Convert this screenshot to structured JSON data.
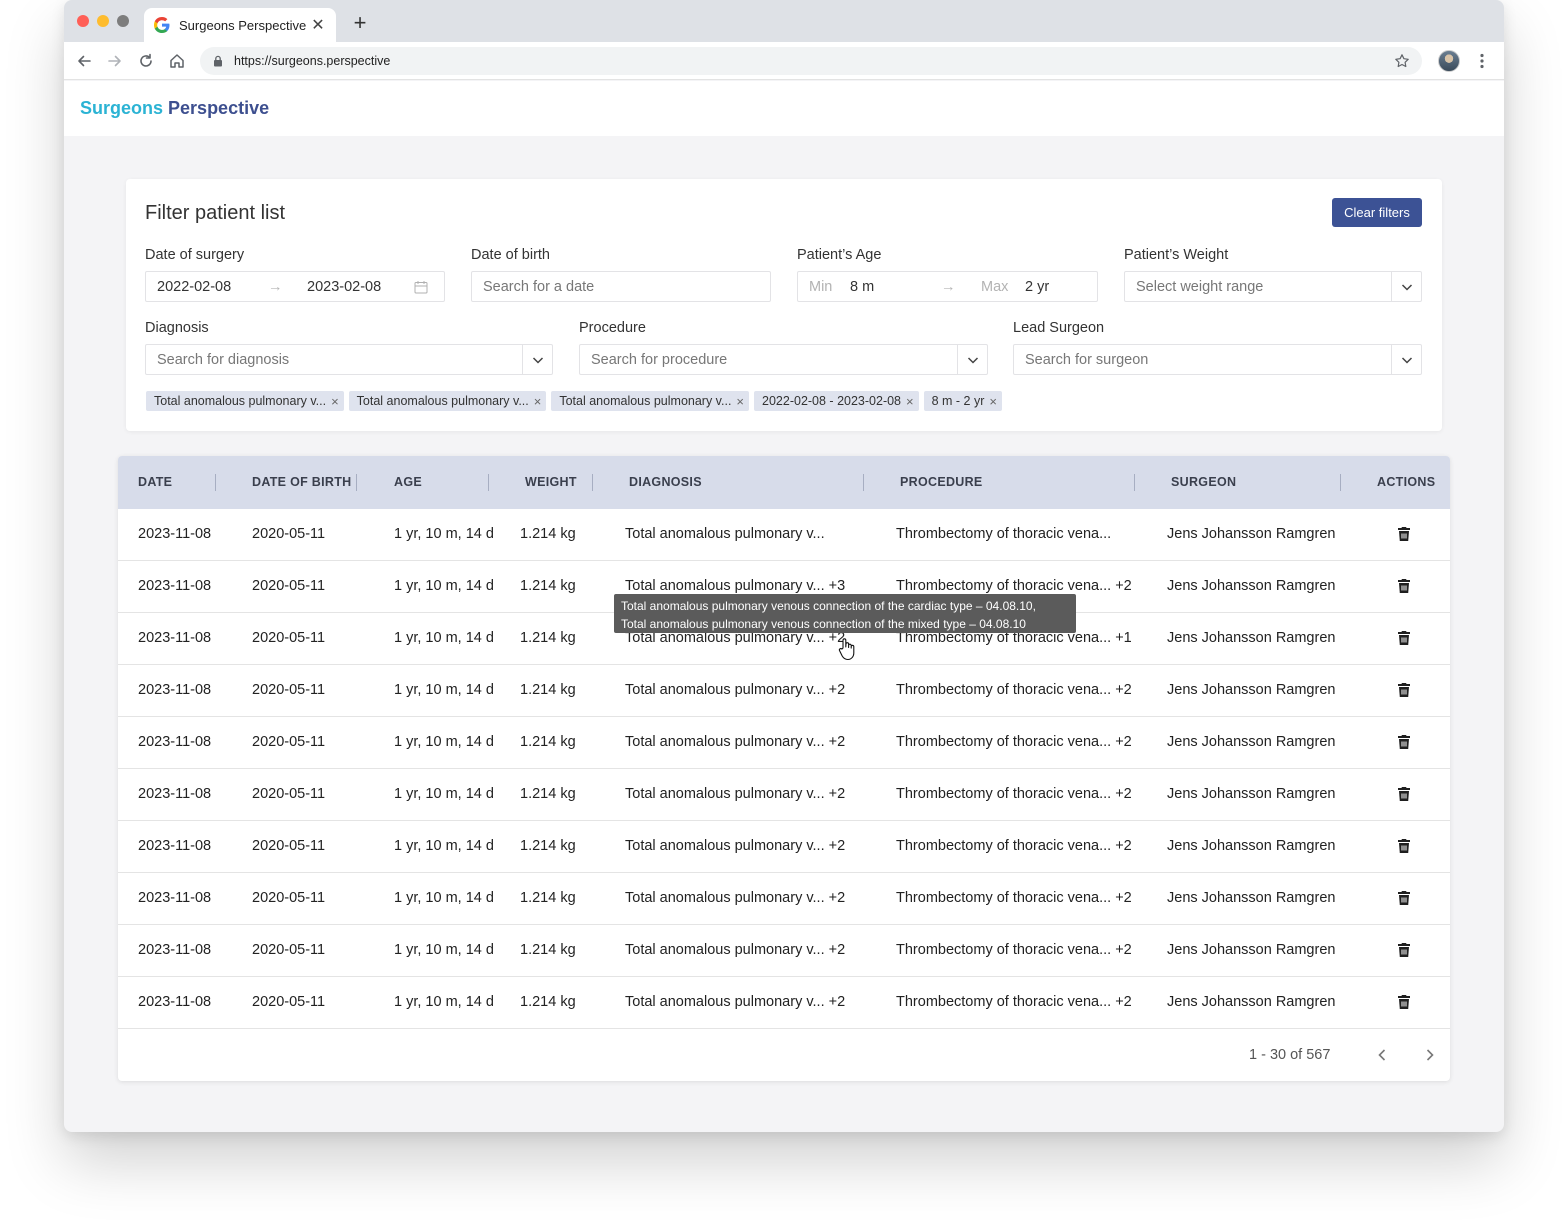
{
  "browser": {
    "tab_title": "Surgeons Perspective",
    "new_tab_label": "+",
    "tab_close_label": "✕",
    "url": "https://surgeons.perspective"
  },
  "app": {
    "brand_part1": "Surgeons",
    "brand_part2": "Perspective"
  },
  "filters": {
    "title": "Filter patient list",
    "clear_button": "Clear filters",
    "surgery_date": {
      "label": "Date of surgery",
      "from": "2022-02-08",
      "to": "2023-02-08"
    },
    "birth_date": {
      "label": "Date of birth",
      "placeholder": "Search for a date"
    },
    "age": {
      "label": "Patient’s Age",
      "min_label": "Min",
      "min_value": "8 m",
      "max_label": "Max",
      "max_value": "2 yr"
    },
    "weight": {
      "label": "Patient’s Weight",
      "placeholder": "Select weight range"
    },
    "diagnosis": {
      "label": "Diagnosis",
      "placeholder": "Search for diagnosis"
    },
    "procedure": {
      "label": "Procedure",
      "placeholder": "Search for procedure"
    },
    "surgeon": {
      "label": "Lead Surgeon",
      "placeholder": "Search for surgeon"
    },
    "chips": [
      "Total anomalous pulmonary v...",
      "Total anomalous pulmonary v...",
      "Total anomalous pulmonary v...",
      "2022-02-08 - 2023-02-08",
      "8 m - 2 yr"
    ],
    "chip_remove": "×"
  },
  "table": {
    "headers": {
      "date": "DATE",
      "dob": "DATE OF BIRTH",
      "age": "AGE",
      "weight": "WEIGHT",
      "diagnosis": "DIAGNOSIS",
      "procedure": "PROCEDURE",
      "surgeon": "SURGEON",
      "actions": "ACTIONS"
    },
    "rows": [
      {
        "date": "2023-11-08",
        "dob": "2020-05-11",
        "age": "1 yr, 10 m, 14 d",
        "weight": "1.214 kg",
        "diagnosis": "Total anomalous pulmonary v...",
        "procedure": "Thrombectomy of thoracic vena...",
        "surgeon": "Jens Johansson Ramgren"
      },
      {
        "date": "2023-11-08",
        "dob": "2020-05-11",
        "age": "1 yr, 10 m, 14 d",
        "weight": "1.214 kg",
        "diagnosis": "Total anomalous pulmonary v... +3",
        "procedure": "Thrombectomy of thoracic vena... +2",
        "surgeon": "Jens Johansson Ramgren"
      },
      {
        "date": "2023-11-08",
        "dob": "2020-05-11",
        "age": "1 yr, 10 m, 14 d",
        "weight": "1.214 kg",
        "diagnosis": "Total anomalous pulmonary v... +2",
        "procedure": "Thrombectomy of thoracic vena... +1",
        "surgeon": "Jens Johansson Ramgren"
      },
      {
        "date": "2023-11-08",
        "dob": "2020-05-11",
        "age": "1 yr, 10 m, 14 d",
        "weight": "1.214 kg",
        "diagnosis": "Total anomalous pulmonary v... +2",
        "procedure": "Thrombectomy of thoracic vena... +2",
        "surgeon": "Jens Johansson Ramgren"
      },
      {
        "date": "2023-11-08",
        "dob": "2020-05-11",
        "age": "1 yr, 10 m, 14 d",
        "weight": "1.214 kg",
        "diagnosis": "Total anomalous pulmonary v... +2",
        "procedure": "Thrombectomy of thoracic vena... +2",
        "surgeon": "Jens Johansson Ramgren"
      },
      {
        "date": "2023-11-08",
        "dob": "2020-05-11",
        "age": "1 yr, 10 m, 14 d",
        "weight": "1.214 kg",
        "diagnosis": "Total anomalous pulmonary v... +2",
        "procedure": "Thrombectomy of thoracic vena... +2",
        "surgeon": "Jens Johansson Ramgren"
      },
      {
        "date": "2023-11-08",
        "dob": "2020-05-11",
        "age": "1 yr, 10 m, 14 d",
        "weight": "1.214 kg",
        "diagnosis": "Total anomalous pulmonary v... +2",
        "procedure": "Thrombectomy of thoracic vena... +2",
        "surgeon": "Jens Johansson Ramgren"
      },
      {
        "date": "2023-11-08",
        "dob": "2020-05-11",
        "age": "1 yr, 10 m, 14 d",
        "weight": "1.214 kg",
        "diagnosis": "Total anomalous pulmonary v... +2",
        "procedure": "Thrombectomy of thoracic vena... +2",
        "surgeon": "Jens Johansson Ramgren"
      },
      {
        "date": "2023-11-08",
        "dob": "2020-05-11",
        "age": "1 yr, 10 m, 14 d",
        "weight": "1.214 kg",
        "diagnosis": "Total anomalous pulmonary v... +2",
        "procedure": "Thrombectomy of thoracic vena... +2",
        "surgeon": "Jens Johansson Ramgren"
      },
      {
        "date": "2023-11-08",
        "dob": "2020-05-11",
        "age": "1 yr, 10 m, 14 d",
        "weight": "1.214 kg",
        "diagnosis": "Total anomalous pulmonary v... +2",
        "procedure": "Thrombectomy of thoracic vena... +2",
        "surgeon": "Jens Johansson Ramgren"
      }
    ],
    "pagination": "1 - 30 of 567",
    "tooltip": {
      "line1": "Total anomalous pulmonary venous connection of the cardiac type –  04.08.10,",
      "line2": "Total anomalous pulmonary venous connection of the mixed type – 04.08.10"
    }
  },
  "colors": {
    "brand_teal": "#2bb3d4",
    "brand_navy": "#3d4f8f",
    "primary_button": "#3c5295",
    "table_header": "#d7dcea",
    "chip": "#dfe3ee"
  }
}
